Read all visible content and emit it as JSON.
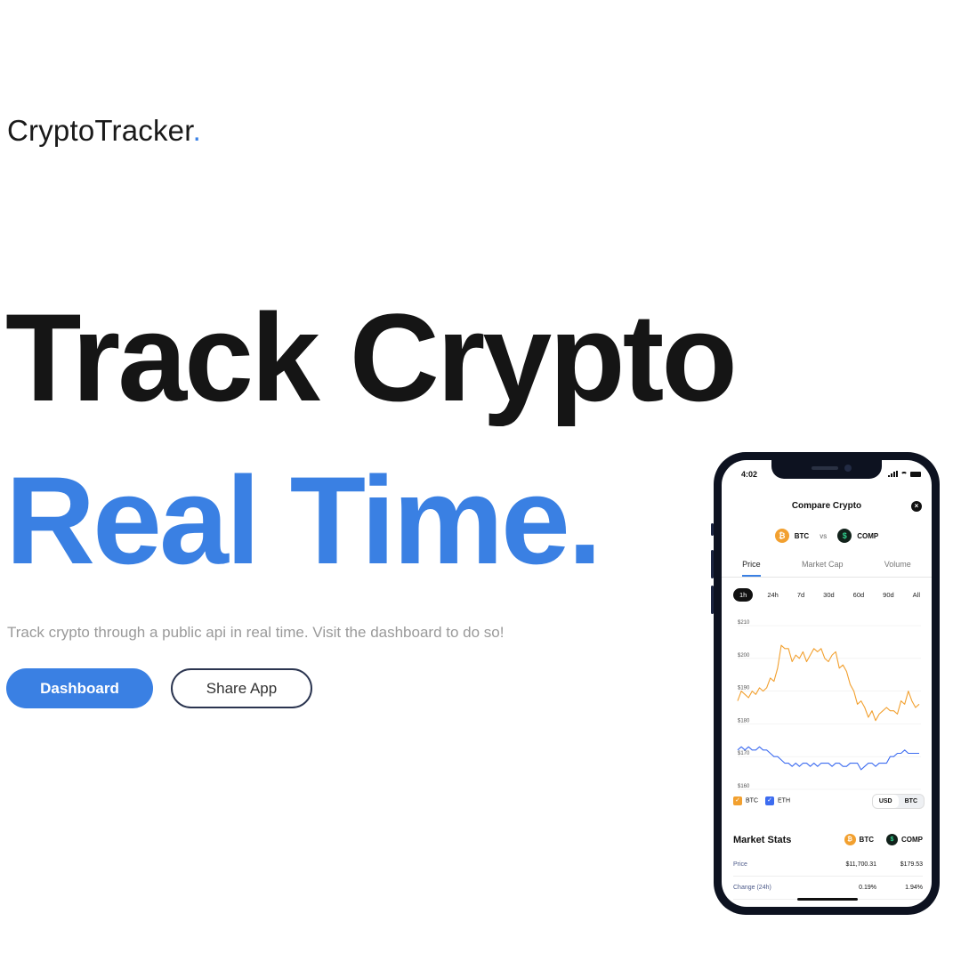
{
  "brand": {
    "name": "CryptoTracker",
    "dot": "."
  },
  "hero": {
    "line1": "Track Crypto",
    "line2": "Real Time.",
    "subtitle": "Track crypto through a public api in real time. Visit the dashboard to do so!"
  },
  "buttons": {
    "dashboard": "Dashboard",
    "share": "Share App"
  },
  "phone": {
    "time": "4:02",
    "title": "Compare Crypto",
    "close_icon": "×",
    "coin1": {
      "symbol": "BTC",
      "icon": "bitcoin-icon",
      "glyph": "₿",
      "color": "#f2a02f"
    },
    "vs": "vs",
    "coin2": {
      "symbol": "COMP",
      "icon": "compound-icon",
      "glyph": "$",
      "color": "#12221b"
    },
    "tabs": [
      "Price",
      "Market Cap",
      "Volume"
    ],
    "ranges": [
      "1h",
      "24h",
      "7d",
      "30d",
      "60d",
      "90d",
      "All"
    ],
    "legend": {
      "btc": "BTC",
      "eth": "ETH"
    },
    "currency": {
      "usd": "USD",
      "btc": "BTC"
    },
    "stats_title": "Market Stats",
    "stats_coin1": "BTC",
    "stats_coin2": "COMP",
    "rows": [
      {
        "label": "Price",
        "v1": "$11,700.31",
        "v2": "$179.53"
      },
      {
        "label": "Change (24h)",
        "v1": "0.19%",
        "v2": "1.94%"
      }
    ]
  },
  "chart_data": {
    "type": "line",
    "yticks": [
      "$210",
      "$200",
      "$190",
      "$180",
      "$170",
      "$160"
    ],
    "ylim": [
      160,
      210
    ],
    "series": [
      {
        "name": "BTC",
        "color": "#f2a02f",
        "values": [
          187,
          190,
          189,
          188,
          190,
          189,
          191,
          190,
          191,
          194,
          193,
          197,
          204,
          203,
          203,
          199,
          201,
          200,
          202,
          199,
          201,
          203,
          202,
          203,
          200,
          199,
          201,
          202,
          197,
          198,
          196,
          192,
          190,
          186,
          187,
          185,
          182,
          184,
          181,
          183,
          184,
          185,
          184,
          184,
          183,
          187,
          186,
          190,
          187,
          185,
          186
        ]
      },
      {
        "name": "ETH",
        "color": "#3d6cf0",
        "values": [
          172,
          173,
          172,
          173,
          172,
          172,
          173,
          172,
          172,
          171,
          170,
          170,
          169,
          168,
          168,
          167,
          168,
          167,
          168,
          168,
          167,
          168,
          167,
          168,
          168,
          168,
          167,
          168,
          168,
          167,
          167,
          168,
          168,
          168,
          166,
          167,
          168,
          168,
          167,
          168,
          168,
          168,
          170,
          170,
          171,
          171,
          172,
          171,
          171,
          171,
          171
        ]
      }
    ]
  }
}
